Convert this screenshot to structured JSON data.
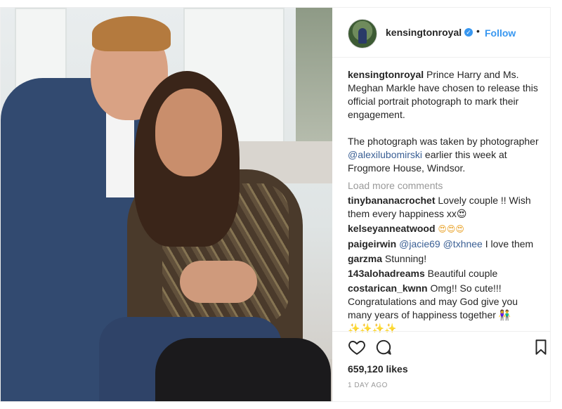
{
  "header": {
    "username": "kensingtonroyal",
    "separator": "•",
    "follow_label": "Follow"
  },
  "caption": {
    "username": "kensingtonroyal",
    "text1": "Prince Harry and Ms. Meghan Markle have chosen to release this official portrait photograph to mark their engagement.",
    "text2a": "The photograph was taken by photographer",
    "mention": "@alexilubomirski",
    "text2b": "earlier this week at Frogmore House, Windsor."
  },
  "load_more": "Load more comments",
  "comments": [
    {
      "user": "tinybananacrochet",
      "text": "Lovely couple !! Wish them every happiness xx😍"
    },
    {
      "user": "kelseyanneatwood",
      "text": "😍😍😍"
    },
    {
      "user": "paigeirwin",
      "mention1": "@jacie69",
      "mention2": "@txhnee",
      "text": "I love them"
    },
    {
      "user": "garzma",
      "text": "Stunning!"
    },
    {
      "user": "143alohadreams",
      "text": "Beautiful couple"
    },
    {
      "user": "costarican_kwnn",
      "text": "Omg!! So cute!!! Congratulations and may God give you many years of happiness together 👫✨✨✨✨"
    }
  ],
  "likes": "659,120 likes",
  "time": "1 DAY AGO",
  "icons": {
    "like": "heart-icon",
    "comment": "comment-bubble-icon",
    "save": "bookmark-icon",
    "verified": "verified-badge-icon"
  },
  "colors": {
    "link": "#3897f0",
    "mention": "#3a5f94",
    "muted": "#999999"
  }
}
